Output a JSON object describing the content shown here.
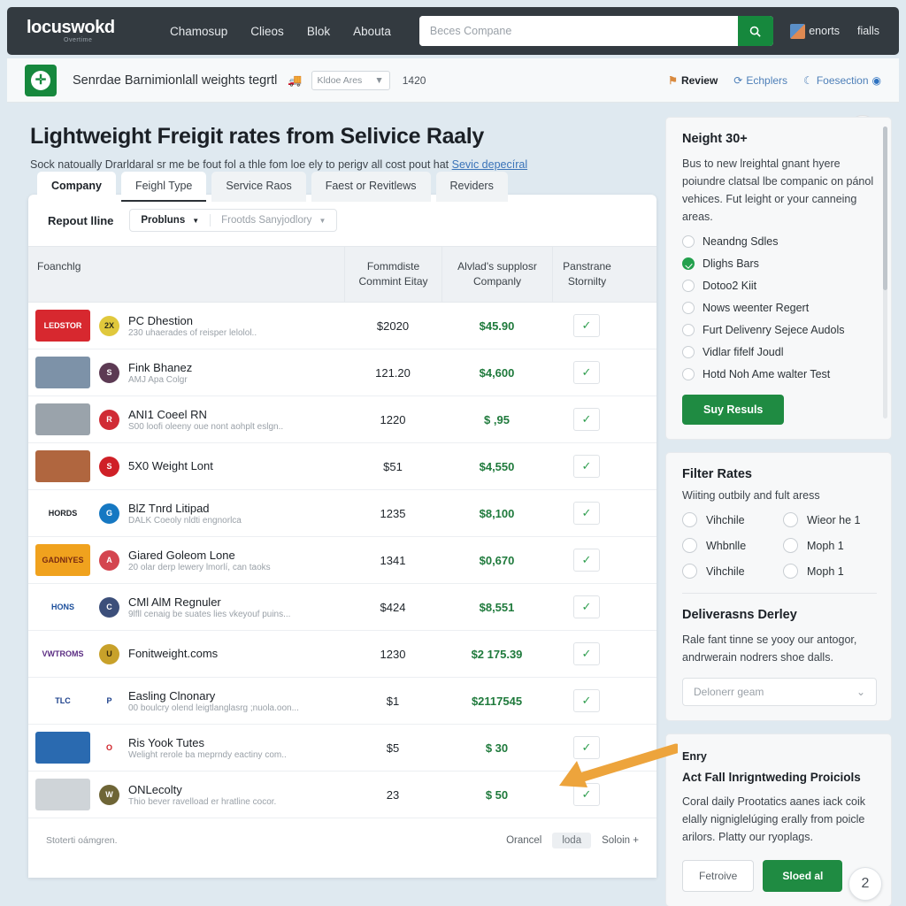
{
  "topnav": {
    "logo": "locuswokd",
    "logo_sub": "Overtime",
    "links": [
      "Chamosup",
      "Clieos",
      "Blok",
      "Abouta"
    ],
    "search_placeholder": "Beces Compane",
    "search_value": "",
    "search_icon": "search-icon",
    "account_label": "enorts",
    "mail_label": "fialls"
  },
  "subheader": {
    "title": "Senrdae Barnimionlall weights tegrtl",
    "icon": "truck-icon",
    "select_value": "Kldoe Ares",
    "number": "1420",
    "links": [
      {
        "label": "Review",
        "icon": "flag-icon"
      },
      {
        "label": "Echplers",
        "icon": "refresh-icon"
      },
      {
        "label": "Foesection",
        "icon": "moon-icon"
      }
    ]
  },
  "hero": {
    "title": "Lightweight Freigit rates from Selivice Raaly",
    "subtitle_prefix": "Sock natoually Drarldaral sr me be fout fol a thle fom loe ely to perigv all cost pout hat ",
    "subtitle_link": "Sevic depecíral",
    "badge_icon": "arrow-up-right-icon"
  },
  "tabs": [
    {
      "label": "Company",
      "state": "active"
    },
    {
      "label": "Feighl Type",
      "state": "underline"
    },
    {
      "label": "Service Raos",
      "state": "idle"
    },
    {
      "label": "Faest or Revitlews",
      "state": "idle"
    },
    {
      "label": "Reviders",
      "state": "idle"
    }
  ],
  "filters": {
    "label": "Repout lline",
    "primary": "Probluns",
    "secondary": "Frootds Sanyjodlory"
  },
  "table": {
    "headers": [
      "Foanchlg",
      "Fommdiste\nCommint Eitay",
      "Alvlad's supplosr\nCompanly",
      "Panstrane\nStornilty"
    ],
    "header_1": "Foanchlg",
    "header_2_l1": "Fommdiste",
    "header_2_l2": "Commint Eitay",
    "header_3_l1": "Alvlad's supplosr",
    "header_3_l2": "Companly",
    "header_4_l1": "Panstrane",
    "header_4_l2": "Stornilty",
    "rows": [
      {
        "logo": "LEDSTOR",
        "logo_bg": "#d7282f",
        "logo_fg": "#ffffff",
        "badge_bg": "#e0c83c",
        "badge_fg": "#2b2b1a",
        "badge_text": "2X",
        "name": "PC Dhestion",
        "desc": "230 uhaerades of reisper lelolol..",
        "col2": "$2020",
        "col3": "$45.90",
        "action": "check-icon"
      },
      {
        "logo": "",
        "logo_bg": "#7d92a8",
        "logo_fg": "#ffffff",
        "badge_bg": "#5c3a53",
        "badge_fg": "#ffffff",
        "badge_text": "S",
        "name": "Fink Bhanez",
        "desc": "AMJ Apa Colgr",
        "col2": "121.20",
        "col3": "$4,600",
        "action": "check-icon"
      },
      {
        "logo": "",
        "logo_bg": "#9aa3ab",
        "logo_fg": "#ffffff",
        "badge_bg": "#d02b35",
        "badge_fg": "#ffffff",
        "badge_text": "R",
        "name": "ANI1 Coeel RN",
        "desc": "S00 loofi oleeny oue nont aohplt eslgn..",
        "col2": "1220",
        "col3": "$ ,95",
        "action": "check-icon"
      },
      {
        "logo": "",
        "logo_bg": "#b0663f",
        "logo_fg": "#ffffff",
        "badge_bg": "#cf2027",
        "badge_fg": "#ffffff",
        "badge_text": "S",
        "name": "5X0 Weight Lont",
        "desc": "",
        "col2": "$51",
        "col3": "$4,550",
        "action": "check-icon"
      },
      {
        "logo": "HORDS",
        "logo_bg": "#ffffff",
        "logo_fg": "#1b2026",
        "badge_bg": "#1678c2",
        "badge_fg": "#ffffff",
        "badge_text": "G",
        "name": "BlZ Tnrd Litipad",
        "desc": "DALK Coeoly nldti engnorlca",
        "col2": "1235",
        "col3": "$8,100",
        "action": "check-icon"
      },
      {
        "logo": "GADNIYES",
        "logo_bg": "#f0a21e",
        "logo_fg": "#7a2b10",
        "badge_bg": "#d4454f",
        "badge_fg": "#ffffff",
        "badge_text": "A",
        "name": "Giared Goleom Lone",
        "desc": "20 olar derp lewery lmorlí, can taoks",
        "col2": "1341",
        "col3": "$0,670",
        "action": "check-icon"
      },
      {
        "logo": "HONS",
        "logo_bg": "#ffffff",
        "logo_fg": "#1b4e9b",
        "badge_bg": "#3c4f7a",
        "badge_fg": "#ffffff",
        "badge_text": "C",
        "name": "CMl AlM Regnuler",
        "desc": "9lfll cenaig be suates lies vkeyouf puins...",
        "col2": "$424",
        "col3": "$8,551",
        "action": "check-icon"
      },
      {
        "logo": "VWTROMS",
        "logo_bg": "#ffffff",
        "logo_fg": "#5b2d83",
        "badge_bg": "#c8a12a",
        "badge_fg": "#3a2a08",
        "badge_text": "U",
        "name": "Fonitweight.coms",
        "desc": "",
        "col2": "1230",
        "col3": "$2 175.39",
        "action": "check-icon"
      },
      {
        "logo": "TLC",
        "logo_bg": "#ffffff",
        "logo_fg": "#1b3f8b",
        "badge_bg": "#ffffff",
        "badge_fg": "#1b3f8b",
        "badge_text": "P",
        "name": "Easling Clnonary",
        "desc": "00 boulcry olend leigtlanglasrg ;nuola.oon...",
        "col2": "$1",
        "col3": "$2117545",
        "action": "check-icon"
      },
      {
        "logo": "",
        "logo_bg": "#2a6ab0",
        "logo_fg": "#ffffff",
        "badge_bg": "#ffffff",
        "badge_fg": "#cf2027",
        "badge_text": "O",
        "name": "Ris Yook Tutes",
        "desc": "Welight rerole ba meprndy eactiny com..",
        "col2": "$5",
        "col3": "$ 30",
        "action": "check-icon"
      },
      {
        "logo": "",
        "logo_bg": "#cfd4d8",
        "logo_fg": "#444444",
        "badge_bg": "#6e6536",
        "badge_fg": "#ffffff",
        "badge_text": "W",
        "name": "ONLecolty",
        "desc": "Thio bever ravelload er hratline cocor.",
        "col2": "23",
        "col3": "$ 50",
        "action": "check-icon"
      }
    ],
    "footer_note": "Stoterti oámgren.",
    "footer_cancel": "Orancel",
    "footer_page": "loda",
    "footer_more": "Soloin +"
  },
  "sidebar": {
    "panel1": {
      "title": "Neight 30+",
      "body": "Bus to new lreightal gnant hyere poiundre clatsal lbe companic on pánol vehices. Fut leight or your canneing areas.",
      "options": [
        {
          "label": "Neandng Sdles",
          "selected": false
        },
        {
          "label": "Dlighs Bars",
          "selected": true
        },
        {
          "label": "Dotoo2 Kiit",
          "selected": false
        },
        {
          "label": "Nows weenter Regert",
          "selected": false
        },
        {
          "label": "Furt Delivenry Sejece Audols",
          "selected": false
        },
        {
          "label": "Vidlar fifelf Joudl",
          "selected": false
        },
        {
          "label": "Hotd Noh Ame walter Test",
          "selected": false
        }
      ],
      "button": "Suy Resuls"
    },
    "panel2": {
      "title": "Filter Rates",
      "sub": "Wiiting outbily and fult aress",
      "options": [
        {
          "label": "Vihchile"
        },
        {
          "label": "Wieor he 1"
        },
        {
          "label": "Whbnlle"
        },
        {
          "label": "Moph 1"
        },
        {
          "label": "Vihchile"
        },
        {
          "label": "Moph 1"
        }
      ]
    },
    "panel3": {
      "title": "Deliverasns Derley",
      "body": "Rale fant tinne se yooy our antogor, andrwerain nodrers shoe dalls.",
      "select_placeholder": "Delonerr geam"
    },
    "panel4": {
      "kicker": "Enry",
      "title": "Act Fall lnrigntweding Proiciols",
      "body": "Coral daily Prootatics aanes iack coik elally nigniglelúging erally from poicle arilors. Platty our ryoplags.",
      "btn_outline": "Fetroive",
      "btn_solid": "Sloed al",
      "bubble": "2"
    }
  },
  "colors": {
    "accent_green": "#1f8b42",
    "nav_dark": "#333a40",
    "link_blue": "#3a73b8"
  }
}
